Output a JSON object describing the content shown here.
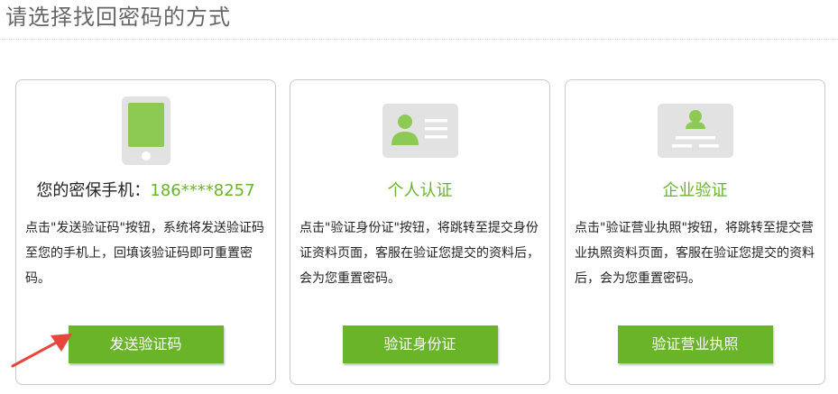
{
  "page": {
    "title": "请选择找回密码的方式"
  },
  "cards": [
    {
      "icon": "mobile-phone-icon",
      "heading_prefix": "您的密保手机：",
      "heading_phone": "186****8257",
      "description": "点击\"发送验证码\"按钮，系统将发送验证码至您的手机上，回填该验证码即可重置密码。",
      "button_label": "发送验证码"
    },
    {
      "icon": "id-card-icon",
      "heading": "个人认证",
      "description": "点击\"验证身份证\"按钮，将跳转至提交身份证资料页面，客服在验证您提交的资料后，会为您重置密码。",
      "button_label": "验证身份证"
    },
    {
      "icon": "business-license-icon",
      "heading": "企业验证",
      "description": "点击\"验证营业执照\"按钮，将跳转至提交营业执照资料页面，客服在验证您提交的资料后，会为您重置密码。",
      "button_label": "验证营业执照"
    }
  ],
  "colors": {
    "accent": "#6ab42a",
    "icon_gray": "#e2e2e2",
    "card_border": "#c9c9c9",
    "annotation_arrow": "#e8453c"
  },
  "annotation": {
    "icon": "red-arrow-icon"
  }
}
